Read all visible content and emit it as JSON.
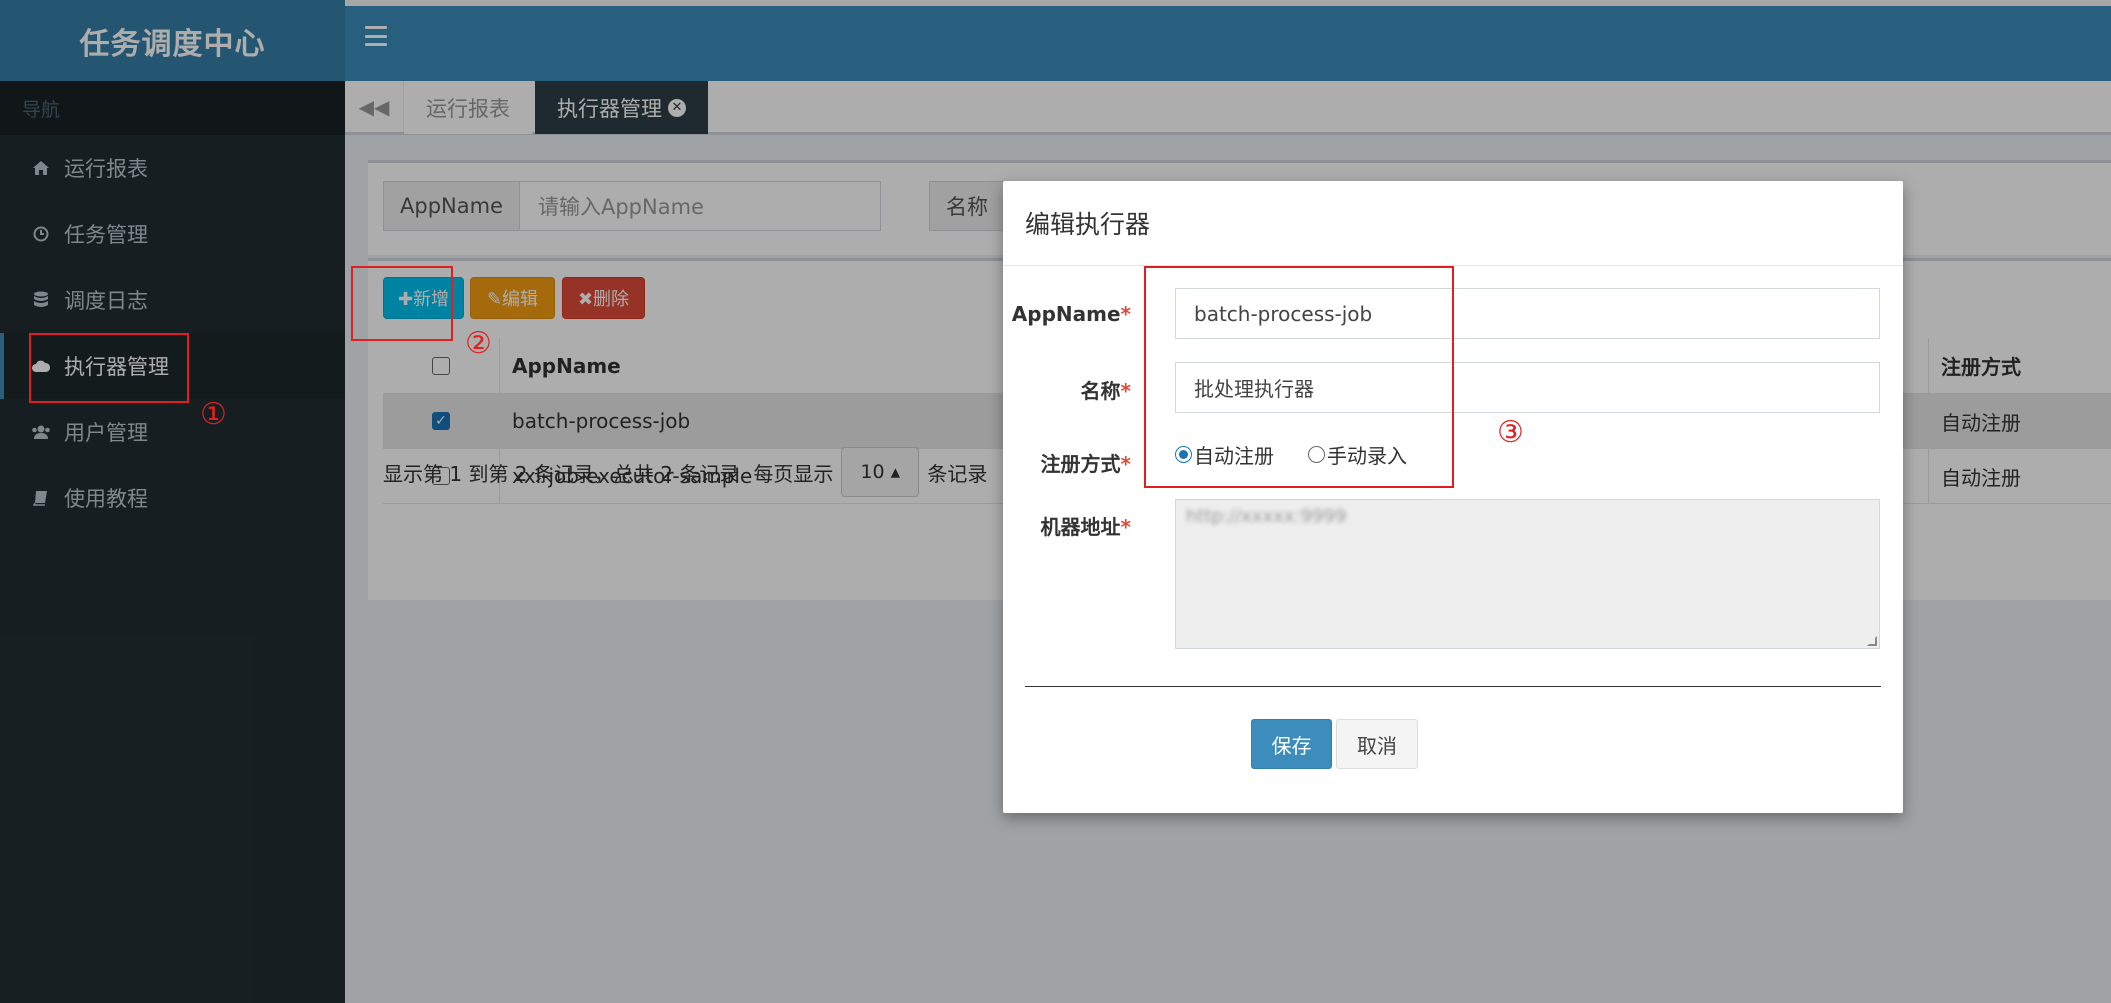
{
  "app_title": "任务调度中心",
  "sidebar": {
    "header": "导航",
    "items": [
      {
        "label": "运行报表",
        "icon": "home-icon"
      },
      {
        "label": "任务管理",
        "icon": "clock-icon"
      },
      {
        "label": "调度日志",
        "icon": "database-icon"
      },
      {
        "label": "执行器管理",
        "icon": "cloud-icon",
        "active": true
      },
      {
        "label": "用户管理",
        "icon": "users-icon"
      },
      {
        "label": "使用教程",
        "icon": "book-icon"
      }
    ]
  },
  "tabs": [
    {
      "label": "运行报表"
    },
    {
      "label": "执行器管理",
      "active": true
    }
  ],
  "search": {
    "appname_label": "AppName",
    "appname_placeholder": "请输入AppName",
    "name_label": "名称"
  },
  "toolbar": {
    "add_label": "✚新增",
    "edit_label": "✎编辑",
    "delete_label": "✖删除"
  },
  "table": {
    "headers": {
      "appname": "AppName",
      "register": "注册方式"
    },
    "rows": [
      {
        "appname": "batch-process-job",
        "register": "自动注册",
        "checked": true
      },
      {
        "appname": "xxl-job-executor-sample",
        "register": "自动注册",
        "checked": false
      }
    ]
  },
  "pager": {
    "summary": "显示第 1 到第 2 条记录，总共 2 条记录",
    "per_page_prefix": "每页显示",
    "page_size": "10 ▴",
    "per_page_suffix": "条记录"
  },
  "modal": {
    "title": "编辑执行器",
    "fields": {
      "appname_label": "AppName",
      "appname_value": "batch-process-job",
      "name_label": "名称",
      "name_value": "批处理执行器",
      "register_label": "注册方式",
      "register_auto": "自动注册",
      "register_manual": "手动录入",
      "address_label": "机器地址",
      "address_value": "http://xxxxx:9999"
    },
    "required_mark": "*",
    "save_label": "保存",
    "cancel_label": "取消"
  },
  "annotations": [
    "①",
    "②",
    "③"
  ],
  "colors": {
    "header": "#3c8dbc",
    "logo": "#367fa9",
    "sidebar": "#222d32",
    "annotation": "#e02020"
  }
}
